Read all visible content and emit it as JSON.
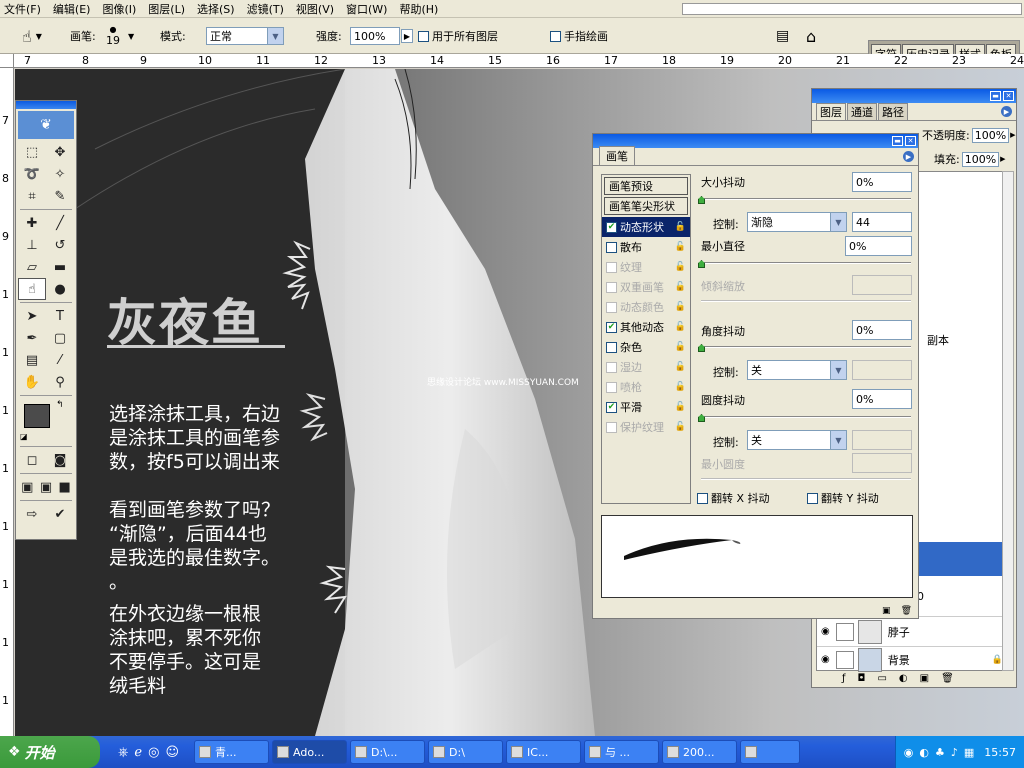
{
  "menu": [
    "文件(F)",
    "编辑(E)",
    "图像(I)",
    "图层(L)",
    "选择(S)",
    "滤镜(T)",
    "视图(V)",
    "窗口(W)",
    "帮助(H)"
  ],
  "options": {
    "brush_label": "画笔:",
    "brush_size": "19",
    "mode_label": "模式:",
    "mode_value": "正常",
    "strength_label": "强度:",
    "strength_value": "100%",
    "all_layers_label": "用于所有图层",
    "finger_paint_label": "手指绘画"
  },
  "palette_well": [
    "字符",
    "历史记录",
    "样式",
    "色板"
  ],
  "ruler_top": [
    "7",
    "8",
    "9",
    "10",
    "11",
    "12",
    "13",
    "14",
    "15",
    "16",
    "17",
    "18",
    "19",
    "20",
    "21",
    "22",
    "23",
    "24"
  ],
  "ruler_left": [
    "7",
    "8",
    "9",
    "1",
    "1",
    "1",
    "1",
    "1",
    "1",
    "1",
    "1",
    "1"
  ],
  "canvas": {
    "title": "灰夜鱼",
    "watermark": "思缘设计论坛 www.MISSYUAN.COM",
    "para1": [
      "选择涂抹工具，右边",
      "是涂抹工具的画笔参",
      "数，按f5可以调出来"
    ],
    "para2": [
      "看到画笔参数了吗？",
      "“渐隐”，后面44也",
      "是我选的最佳数字。",
      "。"
    ],
    "para3": [
      "在外衣边缘一根根",
      "涂抹吧，累不死你",
      "不要停手。这可是",
      "绒毛料"
    ]
  },
  "brushes_panel": {
    "tab": "画笔",
    "presets": "画笔预设",
    "tip_shape": "画笔笔尖形状",
    "items": [
      {
        "label": "动态形状",
        "checked": true,
        "selected": true,
        "disabled": false
      },
      {
        "label": "散布",
        "checked": false,
        "selected": false,
        "disabled": false
      },
      {
        "label": "纹理",
        "checked": false,
        "selected": false,
        "disabled": true
      },
      {
        "label": "双重画笔",
        "checked": false,
        "selected": false,
        "disabled": true
      },
      {
        "label": "动态颜色",
        "checked": false,
        "selected": false,
        "disabled": true
      },
      {
        "label": "其他动态",
        "checked": true,
        "selected": false,
        "disabled": false
      },
      {
        "label": "杂色",
        "checked": false,
        "selected": false,
        "disabled": false
      },
      {
        "label": "湿边",
        "checked": false,
        "selected": false,
        "disabled": true
      },
      {
        "label": "喷枪",
        "checked": false,
        "selected": false,
        "disabled": true
      },
      {
        "label": "平滑",
        "checked": true,
        "selected": false,
        "disabled": false
      },
      {
        "label": "保护纹理",
        "checked": false,
        "selected": false,
        "disabled": true
      }
    ],
    "size_jitter_label": "大小抖动",
    "size_jitter": "0%",
    "control_label": "控制:",
    "control1": "渐隐",
    "control1_steps": "44",
    "min_diameter_label": "最小直径",
    "min_diameter": "0%",
    "tilt_scale_label": "倾斜缩放",
    "angle_jitter_label": "角度抖动",
    "angle_jitter": "0%",
    "control2": "关",
    "roundness_jitter_label": "圆度抖动",
    "roundness_jitter": "0%",
    "control3": "关",
    "min_roundness_label": "最小圆度",
    "flip_x": "翻转 X 抖动",
    "flip_y": "翻转 Y 抖动"
  },
  "layers_panel": {
    "tabs": [
      "图层",
      "通道",
      "路径"
    ],
    "opacity_label": "不透明度:",
    "opacity": "100%",
    "fill_label": "填充:",
    "fill": "100%",
    "layers": [
      "副本",
      "脖子",
      "背景"
    ],
    "stray_digit": "0"
  },
  "taskbar": {
    "start": "开始",
    "buttons": [
      "青...",
      "Ado...",
      "D:\\...",
      "D:\\",
      "IC...",
      "与 ...",
      "200...",
      ""
    ],
    "clock": "15:57"
  }
}
